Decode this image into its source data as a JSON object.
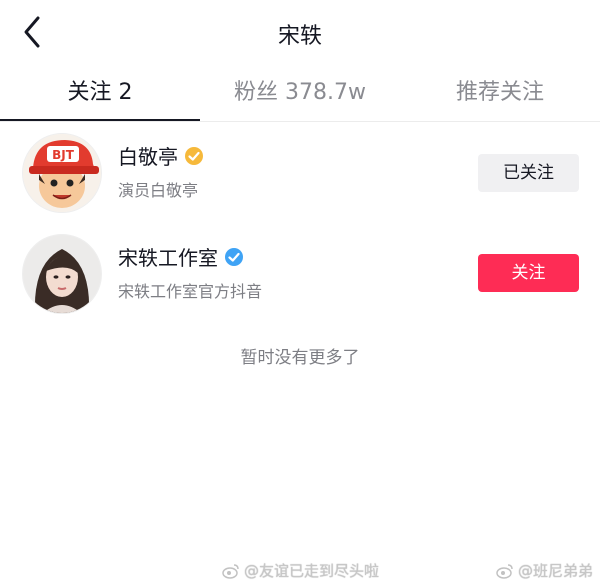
{
  "header": {
    "title": "宋轶",
    "back_icon": "chevron-left-icon"
  },
  "tabs": [
    {
      "label": "关注 2",
      "active": true
    },
    {
      "label": "粉丝 378.7w",
      "active": false
    },
    {
      "label": "推荐关注",
      "active": false
    }
  ],
  "follow_list": [
    {
      "name": "白敬亭",
      "description": "演员白敬亭",
      "verified": "gold",
      "avatar_text": "BJT",
      "button": "已关注"
    },
    {
      "name": "宋轶工作室",
      "description": "宋轶工作室官方抖音",
      "verified": "blue",
      "button": "关注"
    }
  ],
  "footer_note": "暂时没有更多了",
  "watermarks": [
    "@友谊已走到尽头啦",
    "@班尼弟弟"
  ],
  "colors": {
    "follow_button": "#fe2c55",
    "followed_button": "#f0f0f2",
    "verified_gold": "#f6b93b",
    "verified_blue": "#3fa3f5"
  }
}
